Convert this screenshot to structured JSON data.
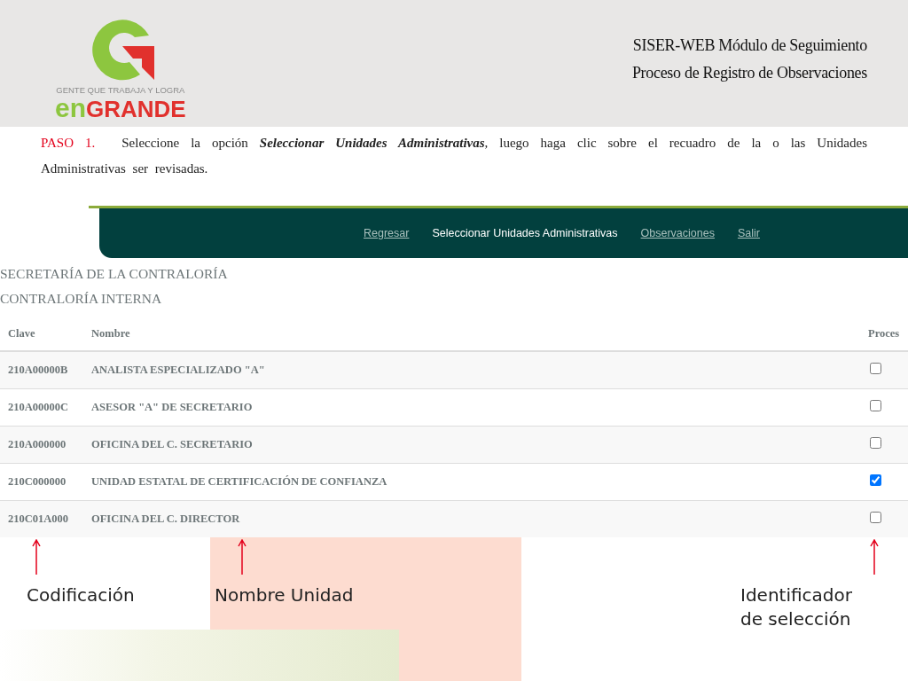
{
  "header": {
    "logo": {
      "tagline": "GENTE QUE TRABAJA Y LOGRA",
      "wordmark_prefix": "en",
      "wordmark": "GRANDE"
    },
    "title_lines": [
      "SISER-WEB Módulo de Seguimiento",
      "Proceso de Registro de Observaciones"
    ]
  },
  "instruction": {
    "step": "PASO 1.",
    "text": "Seleccione la opción **Seleccionar Unidades Administrativas**, luego haga clic sobre el recuadro de la o las Unidades Administrativas  ser revisadas."
  },
  "app": {
    "nav": [
      {
        "label": "Regresar",
        "selected": false
      },
      {
        "label": "Seleccionar Unidades Administrativas",
        "selected": true
      },
      {
        "label": "Observaciones",
        "selected": false
      },
      {
        "label": "Salir",
        "selected": false
      }
    ],
    "headings": [
      "SECRETARÍA DE LA CONTRALORÍA",
      "CONTRALORÍA INTERNA"
    ],
    "table": {
      "columns": [
        "Clave",
        "Nombre",
        "Proces"
      ],
      "rows": [
        {
          "clave": "210A00000B",
          "nombre": "ANALISTA ESPECIALIZADO \"A\"",
          "checked": false
        },
        {
          "clave": "210A00000C",
          "nombre": "ASESOR \"A\" DE SECRETARIO",
          "checked": false
        },
        {
          "clave": "210A000000",
          "nombre": "OFICINA DEL C. SECRETARIO",
          "checked": false
        },
        {
          "clave": "210C000000",
          "nombre": "UNIDAD ESTATAL DE CERTIFICACIÓN DE CONFIANZA",
          "checked": true
        },
        {
          "clave": "210C01A000",
          "nombre": "OFICINA DEL C. DIRECTOR",
          "checked": false
        }
      ]
    }
  },
  "annotations": [
    {
      "label": "Codificación"
    },
    {
      "label": "Nombre Unidad"
    },
    {
      "label": "Identificador\nde selección"
    }
  ]
}
